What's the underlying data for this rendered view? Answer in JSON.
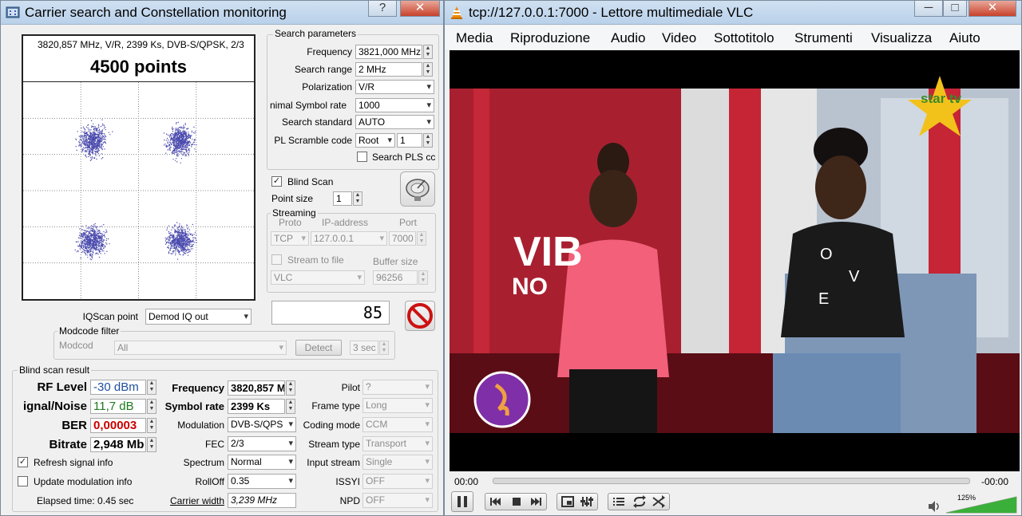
{
  "left_window": {
    "title": "Carrier search and Constellation monitoring",
    "help_button": "?",
    "close_button": "✕",
    "constellation": {
      "header": "3820,857 MHz, V/R, 2399 Ks, DVB-S/QPSK, 2/3",
      "points_label": "4500 points"
    },
    "search_params": {
      "group_label": "Search parameters",
      "frequency_label": "Frequency",
      "frequency_value": "3821,000 MHz",
      "range_label": "Search range",
      "range_value": "2 MHz",
      "polarization_label": "Polarization",
      "polarization_value": "V/R",
      "min_sr_label": "nimal Symbol rate",
      "min_sr_value": "1000",
      "standard_label": "Search standard",
      "standard_value": "AUTO",
      "pl_label": "PL Scramble code",
      "pl_mode": "Root",
      "pl_value": "1",
      "search_pls_label": "Search PLS cc"
    },
    "blind_scan_label": "Blind Scan",
    "point_size_label": "Point size",
    "point_size_value": "1",
    "streaming": {
      "group_label": "Streaming",
      "proto_header": "Proto",
      "ip_header": "IP-address",
      "port_header": "Port",
      "proto_value": "TCP",
      "ip_value": "127.0.0.1",
      "port_value": "7000",
      "stream_file_label": "Stream to file",
      "buffer_label": "Buffer size",
      "player_value": "VLC",
      "buffer_value": "96256"
    },
    "iq_label": "IQScan point",
    "iq_value": "Demod IQ out",
    "counter_value": "85",
    "modcode": {
      "group_label": "Modcode filter",
      "modcode_label": "Modcod",
      "modcode_value": "All",
      "detect_label": "Detect",
      "time_value": "3 sec"
    },
    "result": {
      "group_label": "Blind scan result",
      "rf_label": "RF Level",
      "rf_value": "-30 dBm",
      "snr_label": "ignal/Noise",
      "snr_value": "11,7 dB",
      "ber_label": "BER",
      "ber_value": "0,00003",
      "bitrate_label": "Bitrate",
      "bitrate_value": "2,948 Mb",
      "freq_label": "Frequency",
      "freq_value": "3820,857 M",
      "sr_label": "Symbol rate",
      "sr_value": "2399 Ks",
      "mod_label": "Modulation",
      "mod_value": "DVB-S/QPS",
      "fec_label": "FEC",
      "fec_value": "2/3",
      "spectrum_label": "Spectrum",
      "spectrum_value": "Normal",
      "rolloff_label": "RollOff",
      "rolloff_value": "0.35",
      "carrier_width_label": "Carrier width",
      "carrier_width_value": "3,239 MHz",
      "pilot_label": "Pilot",
      "pilot_value": "?",
      "frame_label": "Frame type",
      "frame_value": "Long",
      "coding_label": "Coding mode",
      "coding_value": "CCM",
      "stream_type_label": "Stream type",
      "stream_type_value": "Transport",
      "input_stream_label": "Input stream",
      "input_stream_value": "Single",
      "issyi_label": "ISSYI",
      "issyi_value": "OFF",
      "npd_label": "NPD",
      "npd_value": "OFF",
      "refresh_label": "Refresh signal info",
      "update_label": "Update modulation info",
      "elapsed_label": "Elapsed time: 0.45 sec"
    }
  },
  "right_window": {
    "title": "tcp://127.0.0.1:7000 - Lettore multimediale VLC",
    "menu": [
      "Media",
      "Riproduzione",
      "Audio",
      "Video",
      "Sottotitolo",
      "Strumenti",
      "Visualizza",
      "Aiuto"
    ],
    "video": {
      "channel_logo": "star tv",
      "bg_text_1": "VIB",
      "bg_text_2": "NO",
      "shirt_letters": [
        "O",
        "V",
        "E"
      ]
    },
    "time_elapsed": "00:00",
    "time_remaining": "-00:00",
    "volume_label": "125%",
    "volume_level": 1.25
  },
  "colors": {
    "rf_value": "#1e4fa0",
    "snr_value": "#1c7a1c",
    "ber_value": "#cc0000",
    "constellation_points": "#2a2aa0",
    "vlc_cone": "#f08a00",
    "stop_icon": "#cc1111"
  }
}
